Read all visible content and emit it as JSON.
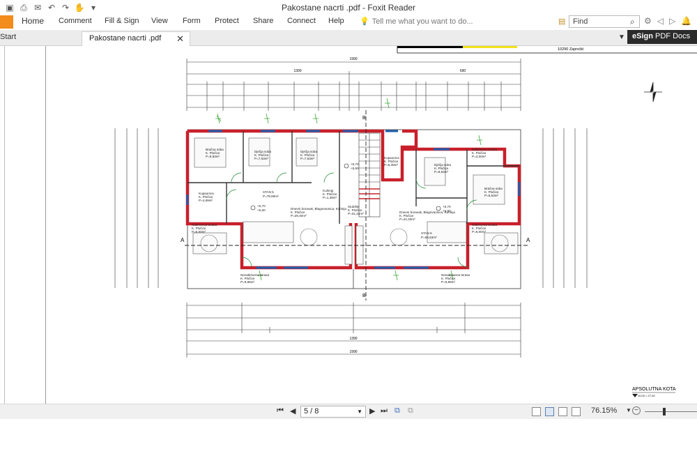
{
  "window": {
    "title": "Pakostane nacrti .pdf - Foxit Reader"
  },
  "ribbon": {
    "home": "Home",
    "comment": "Comment",
    "fill_sign": "Fill & Sign",
    "view": "View",
    "form": "Form",
    "protect": "Protect",
    "share": "Share",
    "connect": "Connect",
    "help": "Help",
    "tell_me": "Tell me what you want to do...",
    "find_placeholder": "Find"
  },
  "tabs": {
    "start": "Start",
    "active": "Pakostane nacrti .pdf"
  },
  "esign": {
    "bold": "eSign",
    "rest": " PDF Docs"
  },
  "plan": {
    "address": "10290 Zaprešić",
    "dim_total": "1990",
    "dim_1300": "1300",
    "dim_690": "690",
    "dim_1390": "1390",
    "section_b": "B",
    "section_a": "A",
    "apsolutna": "APSOLUTNA KOTA",
    "apsolutna_sub": "±0,00 = 27,00",
    "rooms": [
      {
        "name": "Bračna soba",
        "floor": "K. Pločice",
        "area": "P=9,93m²"
      },
      {
        "name": "Dječja soba",
        "floor": "K. Pločice",
        "area": "P=7,63m²"
      },
      {
        "name": "Dječja soba",
        "floor": "K. Pločice",
        "area": "P=7,63m²"
      },
      {
        "name": "Kupaonica",
        "floor": "K. Pločice",
        "area": "P=4,69m²"
      },
      {
        "name": "STAN 5",
        "floor": "",
        "area": "P=78,69m²"
      },
      {
        "name": "Dnevni boravak, Blagovaonica, Kuhinja",
        "floor": "K. Pločice",
        "area": "P=29,40m²"
      },
      {
        "name": "Natkrivena terasa",
        "floor": "K. Pločice",
        "area": "P=6,00m²"
      },
      {
        "name": "Nenatkrivena terasa",
        "floor": "K. Pločice",
        "area": "P=9,86m²"
      },
      {
        "name": "Stubište",
        "floor": "K. Pločice",
        "area": "P=31,44m²"
      },
      {
        "name": "Kupaonica",
        "floor": "K. Pločice",
        "area": "P=5,39m²"
      },
      {
        "name": "Dječja soba",
        "floor": "K. Pločice",
        "area": "P=8,52m²"
      },
      {
        "name": "Natkrivena terasa",
        "floor": "K. Pločice",
        "area": "P=3,00m²"
      },
      {
        "name": "Bračna soba",
        "floor": "K. Pločice",
        "area": "P=8,53m²"
      },
      {
        "name": "Dnevni boravak, Blagovaonica, Kuhinja",
        "floor": "K. Pločice",
        "area": "P=24,33m²"
      },
      {
        "name": "STAN 6",
        "floor": "",
        "area": "P=68,63m²"
      },
      {
        "name": "Natkrivena terasa",
        "floor": "K. Pločice",
        "area": "P=6,00m²"
      },
      {
        "name": "Nenatkrivena terasa",
        "floor": "K. Pločice",
        "area": "P=9,86m²"
      },
      {
        "name": "Kuhinja",
        "floor": "K. Pločice",
        "area": "P=1,39m²"
      }
    ],
    "levels": [
      "+5,70",
      "+5,60"
    ]
  },
  "status": {
    "page_indicator": "5 / 8",
    "zoom": "76.15%"
  },
  "colors": {
    "file_tab": "#f28c1c",
    "wall": "#c8202b",
    "window": "#1f5fb0",
    "vegetation": "#3aa635"
  }
}
